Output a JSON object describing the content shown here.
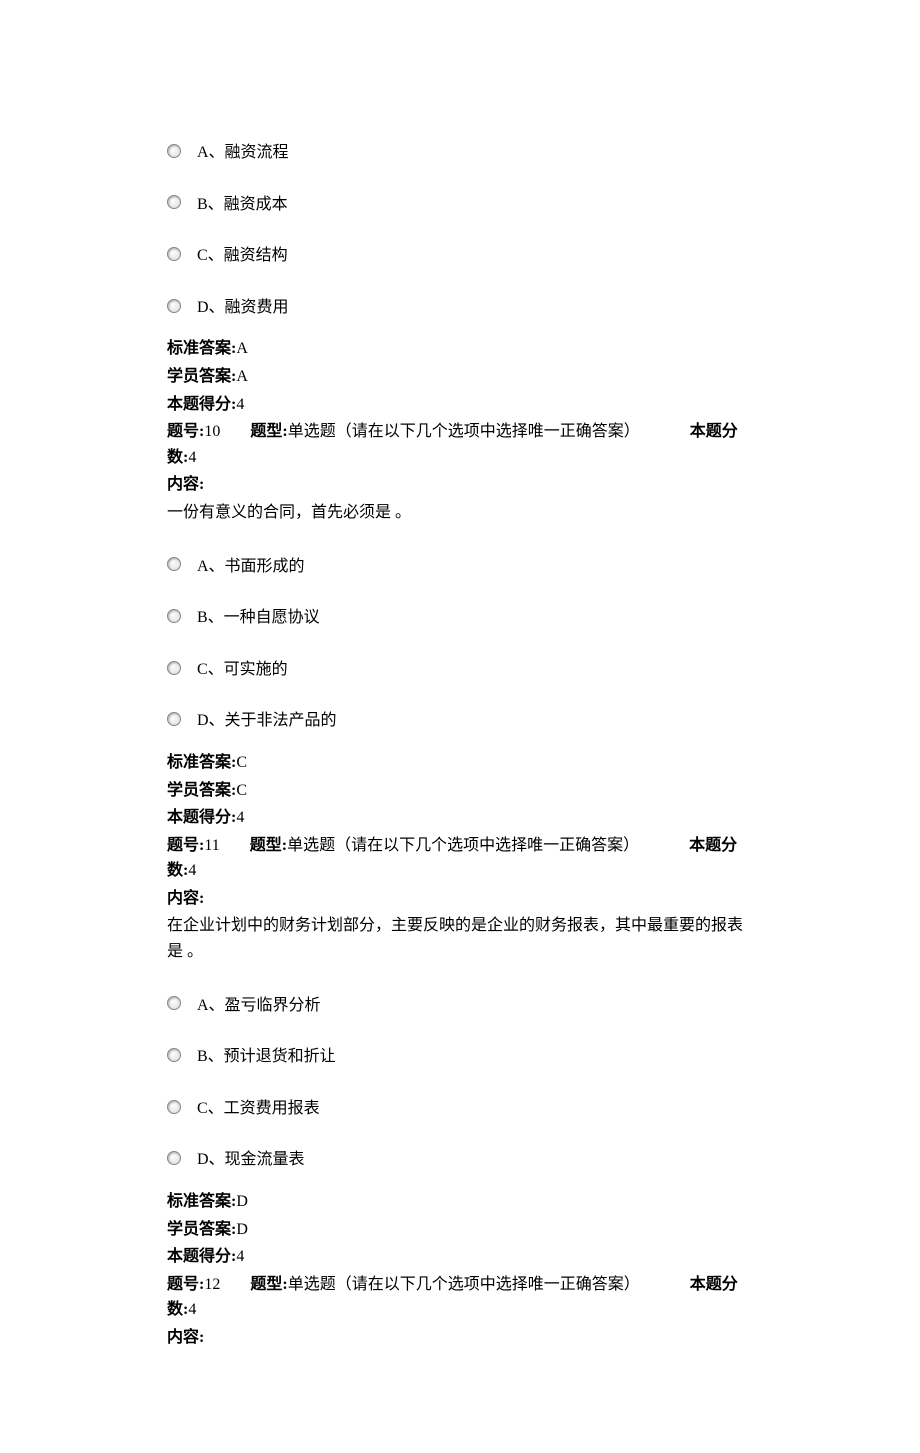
{
  "labels": {
    "standard_answer": "标准答案:",
    "student_answer": "学员答案:",
    "score_obtained": "本题得分:",
    "question_number": "题号:",
    "question_type": "题型:",
    "question_score": "本题分数:",
    "content": "内容:"
  },
  "questions": [
    {
      "options": [
        "A、融资流程",
        "B、融资成本",
        "C、融资结构",
        "D、融资费用"
      ],
      "standard_answer": "A",
      "student_answer": "A",
      "score_obtained": "4"
    },
    {
      "number": "10",
      "type": "单选题（请在以下几个选项中选择唯一正确答案）",
      "score": "4",
      "content_text": "一份有意义的合同，首先必须是 。",
      "options": [
        "A、书面形成的",
        "B、一种自愿协议",
        "C、可实施的",
        "D、关于非法产品的"
      ],
      "standard_answer": "C",
      "student_answer": "C",
      "score_obtained": "4"
    },
    {
      "number": "11",
      "type": "单选题（请在以下几个选项中选择唯一正确答案）",
      "score": "4",
      "content_text": "在企业计划中的财务计划部分，主要反映的是企业的财务报表，其中最重要的报表是 。",
      "options": [
        "A、盈亏临界分析",
        "B、预计退货和折让",
        "C、工资费用报表",
        "D、现金流量表"
      ],
      "standard_answer": "D",
      "student_answer": "D",
      "score_obtained": "4"
    },
    {
      "number": "12",
      "type": "单选题（请在以下几个选项中选择唯一正确答案）",
      "score": "4"
    }
  ]
}
